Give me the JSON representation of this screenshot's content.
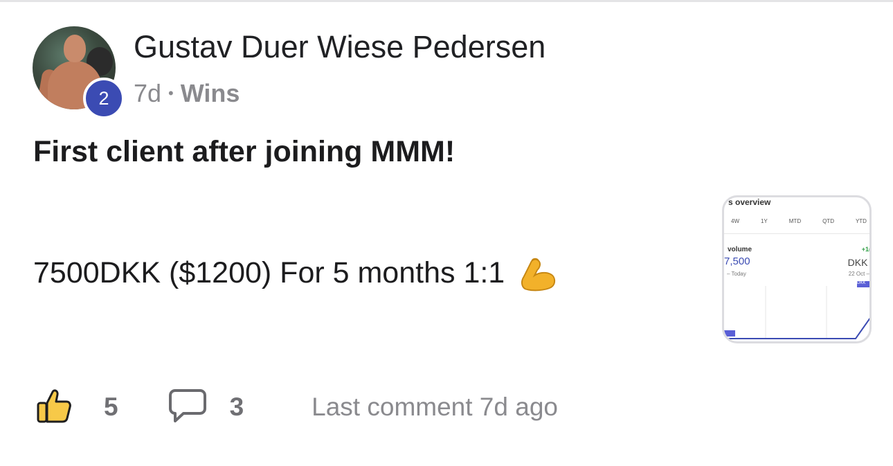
{
  "post": {
    "author_name": "Gustav Duer Wiese Pedersen",
    "level": "2",
    "time_ago": "7d",
    "separator": "•",
    "category": "Wins",
    "title": "First client after joining MMM!",
    "body": "7500DKK ($1200) For 5 months 1:1",
    "body_emoji_icon": "flexed-biceps-icon"
  },
  "attachment_preview": {
    "heading": "s overview",
    "tabs": [
      "4W",
      "1Y",
      "MTD",
      "QTD",
      "YTD"
    ],
    "metric_label": "volume",
    "metric_value": "7,500",
    "period": "– Today",
    "change": "+1(",
    "currency": "DKK (",
    "date": "22 Oct –",
    "badge": "DKK"
  },
  "footer": {
    "like_icon": "thumbs-up-icon",
    "like_count": "5",
    "comment_icon": "comment-bubble-icon",
    "comment_count": "3",
    "last_comment": "Last comment 7d ago"
  },
  "colors": {
    "level_badge": "#3b4bb3",
    "muted_text": "#8a8a8e",
    "like_icon_fill": "#f7c948",
    "chart_line": "#3b4bb3"
  }
}
